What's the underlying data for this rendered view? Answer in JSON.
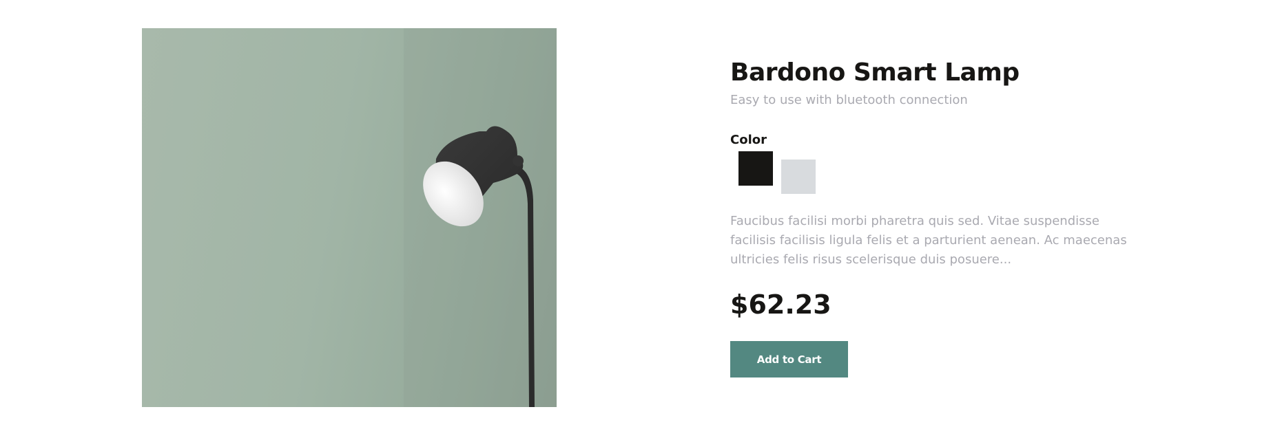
{
  "product": {
    "title": "Bardono Smart Lamp",
    "subtitle": "Easy to use with bluetooth connection",
    "color_label": "Color",
    "colors": [
      {
        "name": "black",
        "hex": "#171614"
      },
      {
        "name": "light-gray",
        "hex": "#d8dbde"
      }
    ],
    "description": "Faucibus facilisi morbi pharetra quis sed. Vitae suspendisse facilisis facilisis ligula felis et a parturient aenean. Ac maecenas ultricies felis risus scelerisque duis posuere...",
    "price": "$62.23",
    "add_to_cart_label": "Add to Cart"
  },
  "theme": {
    "accent": "#538881",
    "text_primary": "#171614",
    "text_muted": "#a9a9b0",
    "image_background": "#a1b5a6"
  }
}
